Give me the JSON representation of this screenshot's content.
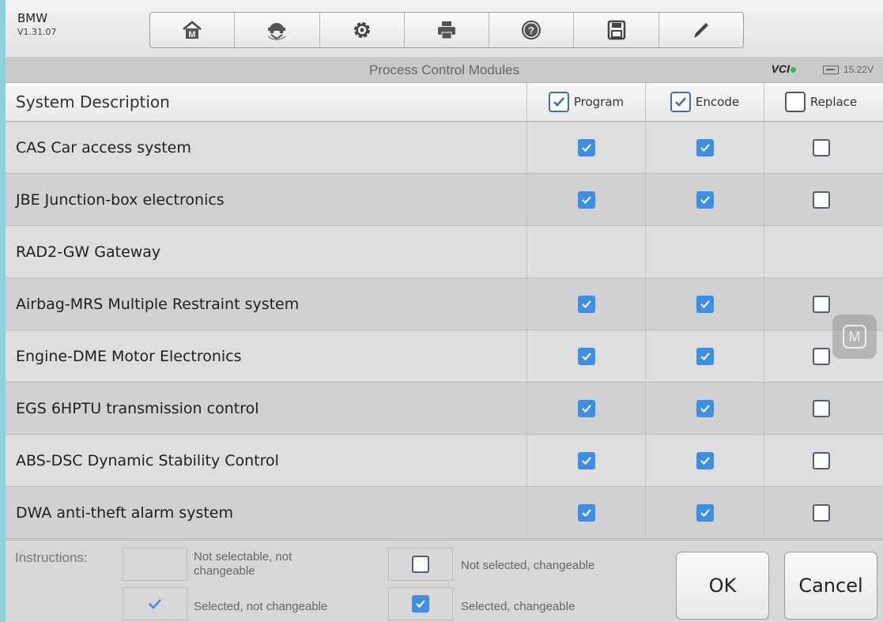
{
  "header": {
    "make": "BMW",
    "version": "V1.31.07",
    "toolbar": [
      {
        "name": "home-button",
        "icon": "home-icon"
      },
      {
        "name": "vehicle-swap-button",
        "icon": "vehicle-swap-icon"
      },
      {
        "name": "settings-button",
        "icon": "gear-icon"
      },
      {
        "name": "print-button",
        "icon": "printer-icon"
      },
      {
        "name": "help-button",
        "icon": "help-icon"
      },
      {
        "name": "save-button",
        "icon": "save-icon"
      },
      {
        "name": "edit-button",
        "icon": "pen-icon"
      }
    ]
  },
  "titlebar": {
    "title": "Process Control Modules",
    "vci_label": "VCI",
    "voltage": "15.22V"
  },
  "table": {
    "col_desc": "System Description",
    "col_program": "Program",
    "col_encode": "Encode",
    "col_replace": "Replace",
    "rows": [
      {
        "desc": "CAS Car access system",
        "program": "on",
        "encode": "on",
        "replace": "off"
      },
      {
        "desc": "JBE Junction-box electronics",
        "program": "on",
        "encode": "on",
        "replace": "off"
      },
      {
        "desc": "RAD2-GW Gateway",
        "program": "none",
        "encode": "none",
        "replace": "none"
      },
      {
        "desc": "Airbag-MRS Multiple Restraint system",
        "program": "on",
        "encode": "on",
        "replace": "off"
      },
      {
        "desc": "Engine-DME Motor Electronics",
        "program": "on",
        "encode": "on",
        "replace": "off"
      },
      {
        "desc": "EGS 6HPTU transmission control",
        "program": "on",
        "encode": "on",
        "replace": "off"
      },
      {
        "desc": "ABS-DSC Dynamic Stability Control",
        "program": "on",
        "encode": "on",
        "replace": "off"
      },
      {
        "desc": "DWA anti-theft alarm system",
        "program": "on",
        "encode": "on",
        "replace": "off"
      }
    ]
  },
  "footer": {
    "instructions_label": "Instructions:",
    "legend_not_selectable": "Not selectable, not changeable",
    "legend_selected_fixed": "Selected, not changeable",
    "legend_not_selected": "Not selected, changeable",
    "legend_selected": "Selected, changeable",
    "ok_label": "OK",
    "cancel_label": "Cancel"
  },
  "colors": {
    "checkbox_on": "#3d8ee6",
    "background_frame": "#8fd0e0"
  }
}
